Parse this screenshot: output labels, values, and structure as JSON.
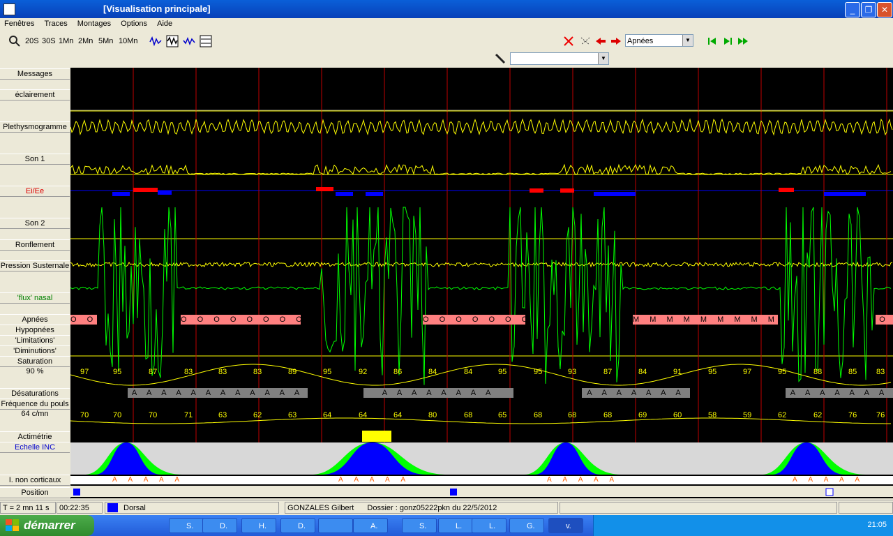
{
  "window": {
    "title": "[Visualisation principale]"
  },
  "menu": [
    "Fenêtres",
    "Traces",
    "Montages",
    "Options",
    "Aide"
  ],
  "toolbar": {
    "time_scales": [
      "20S",
      "30S",
      "1Mn",
      "2Mn",
      "5Mn",
      "10Mn"
    ],
    "event_select": "Apnées",
    "pen_select": ""
  },
  "channels": [
    "Messages",
    "éclairement",
    "Plethysmogramme",
    "Son 1",
    "Ei/Ee",
    "Son 2",
    "Ronflement",
    "Pression Susternale",
    "'flux' nasal",
    "Apnées",
    "Hypopnées",
    "'Limitations'",
    "'Diminutions'",
    "Saturation",
    "90 %",
    "Désaturations",
    "Fréquence du pouls",
    "64 c/mn",
    "Actimétrie",
    "Echelle INC",
    "I. non corticaux",
    "Position"
  ],
  "events": {
    "apnea_o_blocks": [
      {
        "text": "O O"
      },
      {
        "text": "O O O O O O O O"
      },
      {
        "text": "O O O O O O O"
      },
      {
        "text": "M M M M M M M M M"
      },
      {
        "text": "O"
      }
    ],
    "desat_blocks": [
      {
        "text": "A A A A A A A A A A A A"
      },
      {
        "text": "A A A A A A A A"
      },
      {
        "text": "A A A A A A A"
      },
      {
        "text": "A A A A A A A"
      }
    ]
  },
  "saturation_values": [
    {
      "v": "97",
      "left": 0.012
    },
    {
      "v": "95",
      "left": 0.052
    },
    {
      "v": "87",
      "left": 0.095
    },
    {
      "v": "83",
      "left": 0.138
    },
    {
      "v": "83",
      "left": 0.18
    },
    {
      "v": "83",
      "left": 0.222
    },
    {
      "v": "89",
      "left": 0.265
    },
    {
      "v": "95",
      "left": 0.307
    },
    {
      "v": "92",
      "left": 0.35
    },
    {
      "v": "86",
      "left": 0.393
    },
    {
      "v": "84",
      "left": 0.435
    },
    {
      "v": "84",
      "left": 0.478
    },
    {
      "v": "95",
      "left": 0.52
    },
    {
      "v": "95",
      "left": 0.563
    },
    {
      "v": "93",
      "left": 0.605
    },
    {
      "v": "87",
      "left": 0.648
    },
    {
      "v": "84",
      "left": 0.69
    },
    {
      "v": "91",
      "left": 0.733
    },
    {
      "v": "95",
      "left": 0.775
    },
    {
      "v": "97",
      "left": 0.818
    },
    {
      "v": "95",
      "left": 0.86
    },
    {
      "v": "88",
      "left": 0.903
    },
    {
      "v": "85",
      "left": 0.946
    },
    {
      "v": "83",
      "left": 0.98
    }
  ],
  "pulse_values": [
    {
      "v": "70",
      "left": 0.012
    },
    {
      "v": "70",
      "left": 0.052
    },
    {
      "v": "70",
      "left": 0.095
    },
    {
      "v": "71",
      "left": 0.138
    },
    {
      "v": "63",
      "left": 0.18
    },
    {
      "v": "62",
      "left": 0.222
    },
    {
      "v": "63",
      "left": 0.265
    },
    {
      "v": "64",
      "left": 0.307
    },
    {
      "v": "64",
      "left": 0.35
    },
    {
      "v": "64",
      "left": 0.393
    },
    {
      "v": "80",
      "left": 0.435
    },
    {
      "v": "68",
      "left": 0.478
    },
    {
      "v": "65",
      "left": 0.52
    },
    {
      "v": "68",
      "left": 0.563
    },
    {
      "v": "68",
      "left": 0.605
    },
    {
      "v": "68",
      "left": 0.648
    },
    {
      "v": "69",
      "left": 0.69
    },
    {
      "v": "60",
      "left": 0.733
    },
    {
      "v": "58",
      "left": 0.775
    },
    {
      "v": "59",
      "left": 0.818
    },
    {
      "v": "62",
      "left": 0.86
    },
    {
      "v": "62",
      "left": 0.903
    },
    {
      "v": "76",
      "left": 0.946
    },
    {
      "v": "76",
      "left": 0.98
    }
  ],
  "arousal_text": "A A A A A",
  "status": {
    "time": "T = 2 mn 11 s",
    "clock": "00:22:35",
    "position": "Dorsal",
    "patient": "GONZALES  Gilbert",
    "dossier": "Dossier : gonz05222pkn du 22/5/2012"
  },
  "taskbar": {
    "start": "démarrer",
    "tasks": [
      "S.",
      "D.",
      "H.",
      "D.",
      "",
      "A.",
      "S.",
      "L.",
      "L.",
      "G.",
      "v."
    ],
    "clock": "21:05"
  },
  "colors": {
    "red": "#ff0000",
    "yellow": "#ffff00",
    "green": "#00ff00",
    "blue": "#0000ff",
    "salmon": "#ff8080",
    "grey": "#808080"
  }
}
